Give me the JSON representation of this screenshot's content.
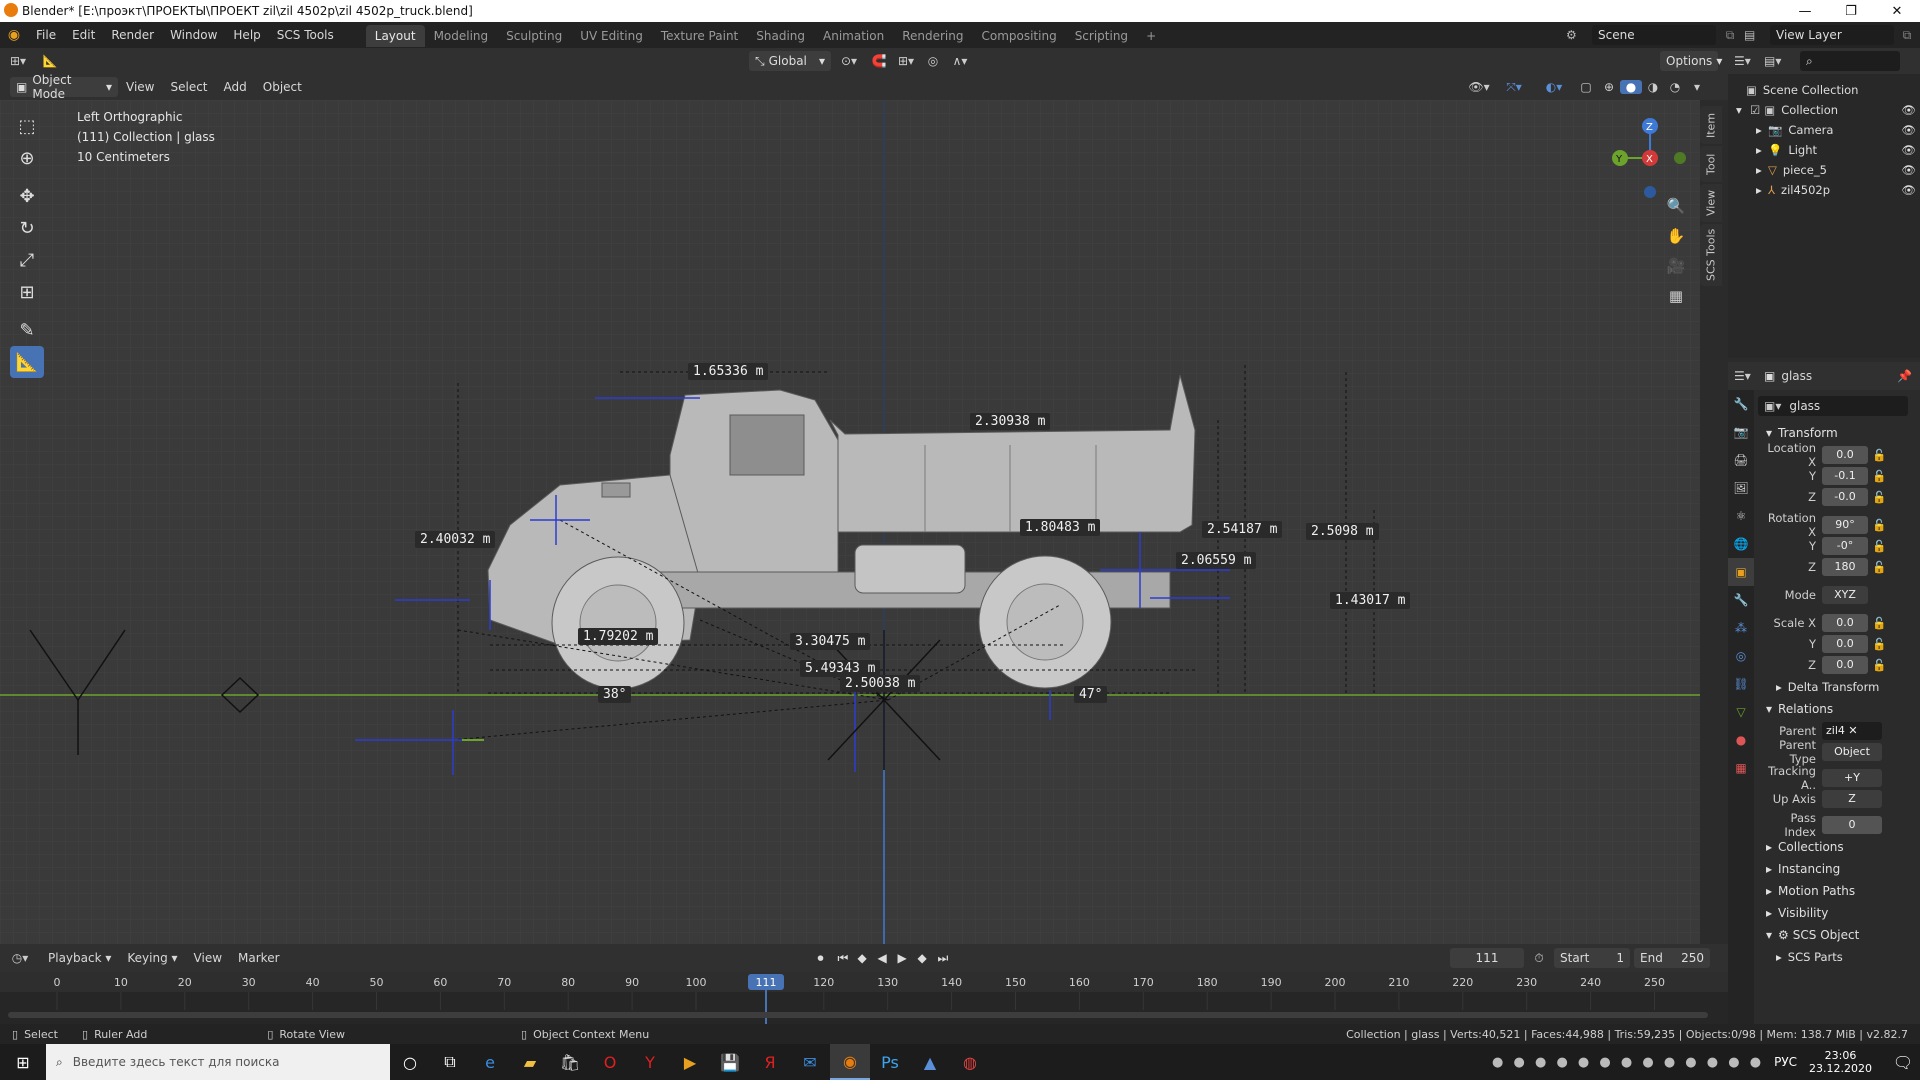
{
  "window": {
    "title": "Blender* [E:\\проэкт\\ПРОЕКТЫ\\ПРОЕКТ zil\\zil 4502p\\zil 4502p_truck.blend]",
    "minimize": "—",
    "maximize": "❐",
    "close": "✕"
  },
  "menu": {
    "items": [
      "File",
      "Edit",
      "Render",
      "Window",
      "Help",
      "SCS Tools"
    ]
  },
  "workspaces": [
    "Layout",
    "Modeling",
    "Sculpting",
    "UV Editing",
    "Texture Paint",
    "Shading",
    "Animation",
    "Rendering",
    "Compositing",
    "Scripting"
  ],
  "scene": {
    "label": "Scene",
    "view_layer": "View Layer"
  },
  "viewport_header": {
    "transform_orientation": "Global",
    "options": "Options",
    "mode": "Object Mode",
    "menus": [
      "View",
      "Select",
      "Add",
      "Object"
    ]
  },
  "viewport_overlay": {
    "view_name": "Left Orthographic",
    "collection_info": "(111) Collection | glass",
    "scale": "10 Centimeters"
  },
  "side_tabs": [
    "Item",
    "Tool",
    "View",
    "SCS Tools"
  ],
  "gizmo": {
    "z": "Z",
    "y": "Y",
    "x": "X"
  },
  "measurements": [
    {
      "text": "1.65336 m"
    },
    {
      "text": "2.30938 m"
    },
    {
      "text": "2.40032 m"
    },
    {
      "text": "1.80483 m"
    },
    {
      "text": "2.54187 m"
    },
    {
      "text": "2.5098 m"
    },
    {
      "text": "2.06559 m"
    },
    {
      "text": "1.43017 m"
    },
    {
      "text": "1.79202 m"
    },
    {
      "text": "3.30475 m"
    },
    {
      "text": "5.49343 m"
    },
    {
      "text": "2.50038 m"
    },
    {
      "text": "38°"
    },
    {
      "text": "47°"
    }
  ],
  "outliner": {
    "root": "Scene Collection",
    "collection": "Collection",
    "items": [
      {
        "name": "Camera",
        "icon": "camera-icon"
      },
      {
        "name": "Light",
        "icon": "light-icon"
      },
      {
        "name": "piece_5",
        "icon": "mesh-icon"
      },
      {
        "name": "zil4502p",
        "icon": "armature-icon"
      }
    ]
  },
  "properties": {
    "object_name": "glass",
    "data_name": "glass",
    "transform_header": "Transform",
    "location": {
      "label": "Location X",
      "x": "0.0",
      "y": "-0.1",
      "z": "-0.0"
    },
    "rotation": {
      "label": "Rotation X",
      "x": "90°",
      "y": "-0°",
      "z": "180"
    },
    "mode": {
      "label": "Mode",
      "value": "XYZ"
    },
    "scale": {
      "label": "Scale X",
      "x": "0.0",
      "y": "0.0",
      "z": "0.0"
    },
    "axis_y": "Y",
    "axis_z": "Z",
    "delta_transform": "Delta Transform",
    "relations_header": "Relations",
    "parent": {
      "label": "Parent",
      "value": "zil4"
    },
    "parent_type": {
      "label": "Parent Type",
      "value": "Object"
    },
    "tracking": {
      "label": "Tracking A..",
      "value": "+Y"
    },
    "up_axis": {
      "label": "Up Axis",
      "value": "Z"
    },
    "pass_index": {
      "label": "Pass Index",
      "value": "0"
    },
    "collapsed": [
      "Collections",
      "Instancing",
      "Motion Paths",
      "Visibility"
    ],
    "scs_object": "SCS Object",
    "scs_parts": "SCS Parts"
  },
  "timeline": {
    "menus": [
      "Playback",
      "Keying",
      "View",
      "Marker"
    ],
    "current_frame": "111",
    "start_label": "Start",
    "start": "1",
    "end_label": "End",
    "end": "250",
    "ticks": [
      "0",
      "10",
      "20",
      "30",
      "40",
      "50",
      "60",
      "70",
      "80",
      "90",
      "100",
      "120",
      "130",
      "140",
      "150",
      "160",
      "170",
      "180",
      "190",
      "200",
      "210",
      "220",
      "230",
      "240",
      "250"
    ]
  },
  "statusbar": {
    "select": "Select",
    "ruler_add": "Ruler Add",
    "rotate_view": "Rotate View",
    "context_menu": "Object Context Menu",
    "stats": "Collection | glass | Verts:40,521 | Faces:44,988 | Tris:59,235 | Objects:0/98 | Mem: 138.7 MiB | v2.82.7"
  },
  "taskbar": {
    "search_placeholder": "Введите здесь текст для поиска",
    "lang": "РУС",
    "time": "23:06",
    "date": "23.12.2020"
  },
  "colors": {
    "accent": "#4772b3",
    "active_frame": "#4772b3",
    "axis_green": "#6ba32c",
    "axis_blue": "#3f79d6"
  }
}
